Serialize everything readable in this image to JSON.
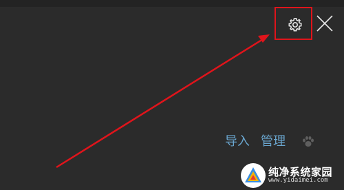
{
  "header": {
    "settings_icon": "gear-icon",
    "close_icon": "close-icon"
  },
  "annotation": {
    "color": "#e0141b"
  },
  "actions": {
    "import_label": "导入",
    "manage_label": "管理"
  },
  "watermark": {
    "name": "纯净系统家园",
    "url": "www.yidaimei.com"
  },
  "colors": {
    "background": "#2b2b2b",
    "link": "#6aa6cf",
    "icon": "#e6e6e6"
  }
}
